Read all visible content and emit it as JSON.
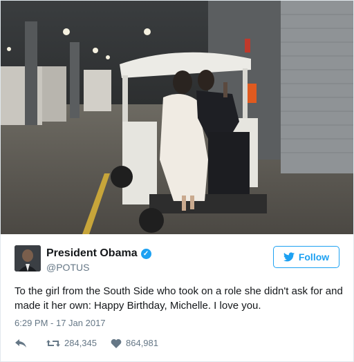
{
  "tweet": {
    "display_name": "President Obama",
    "handle": "@POTUS",
    "follow_label": "Follow",
    "text": "To the girl from the South Side who took on a role she didn't ask for and made it her own: Happy Birthday, Michelle. I love you.",
    "timestamp": "6:29 PM - 17 Jan 2017",
    "retweets": "284,345",
    "likes": "864,981"
  },
  "icons": {
    "verified": "verified-badge-icon",
    "follow_bird": "twitter-bird-icon",
    "reply": "reply-icon",
    "retweet": "retweet-icon",
    "like": "heart-icon"
  },
  "colors": {
    "accent": "#1da1f2",
    "muted_text": "#657786",
    "primary_text": "#14171a",
    "border": "#e1e8ed"
  }
}
